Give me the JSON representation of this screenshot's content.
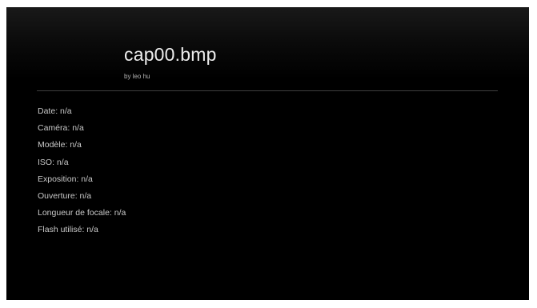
{
  "header": {
    "title": "cap00.bmp",
    "byline": "by leo hu"
  },
  "metadata": {
    "rows": [
      {
        "label": "Date",
        "value": "n/a"
      },
      {
        "label": "Caméra",
        "value": "n/a"
      },
      {
        "label": "Modèle",
        "value": "n/a"
      },
      {
        "label": "ISO",
        "value": "n/a"
      },
      {
        "label": "Exposition",
        "value": "n/a"
      },
      {
        "label": "Ouverture",
        "value": "n/a"
      },
      {
        "label": "Longueur de focale",
        "value": "n/a"
      },
      {
        "label": "Flash utilisé",
        "value": "n/a"
      }
    ]
  }
}
